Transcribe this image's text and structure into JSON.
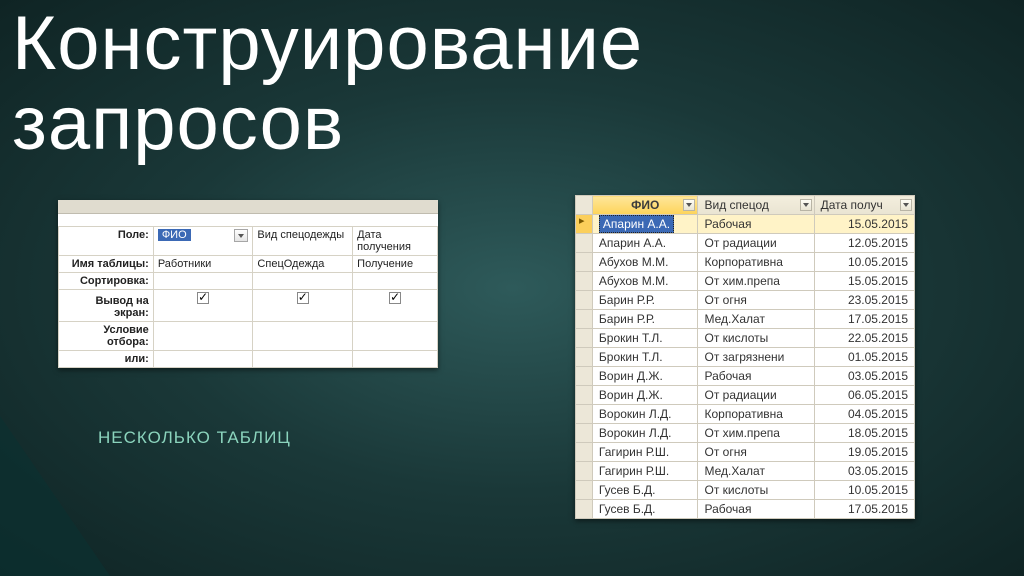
{
  "title_line1": "Конструирование",
  "title_line2": "запросов",
  "subtitle": "НЕСКОЛЬКО ТАБЛИЦ",
  "design": {
    "labels": {
      "field": "Поле:",
      "table": "Имя таблицы:",
      "sort": "Сортировка:",
      "show": "Вывод на экран:",
      "criteria": "Условие отбора:",
      "or": "или:"
    },
    "cols": [
      {
        "field": "ФИО",
        "table": "Работники",
        "show": true,
        "selected": true,
        "combo": true
      },
      {
        "field": "Вид спецодежды",
        "table": "СпецОдежда",
        "show": true
      },
      {
        "field": "Дата получения",
        "table": "Получение",
        "show": true
      }
    ]
  },
  "result": {
    "headers": {
      "fio": "ФИО",
      "vid": "Вид спецод",
      "date": "Дата получ"
    },
    "rows": [
      {
        "fio": "Апарин А.А.",
        "vid": "Рабочая",
        "date": "15.05.2015",
        "selected": true
      },
      {
        "fio": "Апарин А.А.",
        "vid": "От радиации",
        "date": "12.05.2015"
      },
      {
        "fio": "Абухов М.М.",
        "vid": "Корпоративна",
        "date": "10.05.2015"
      },
      {
        "fio": "Абухов М.М.",
        "vid": "От хим.препа",
        "date": "15.05.2015"
      },
      {
        "fio": "Барин Р.Р.",
        "vid": "От огня",
        "date": "23.05.2015"
      },
      {
        "fio": "Барин Р.Р.",
        "vid": "Мед.Халат",
        "date": "17.05.2015"
      },
      {
        "fio": "Брокин Т.Л.",
        "vid": "От кислоты",
        "date": "22.05.2015"
      },
      {
        "fio": "Брокин Т.Л.",
        "vid": "От загрязнени",
        "date": "01.05.2015"
      },
      {
        "fio": "Ворин Д.Ж.",
        "vid": "Рабочая",
        "date": "03.05.2015"
      },
      {
        "fio": "Ворин Д.Ж.",
        "vid": "От радиации",
        "date": "06.05.2015"
      },
      {
        "fio": "Ворокин Л.Д.",
        "vid": "Корпоративна",
        "date": "04.05.2015"
      },
      {
        "fio": "Ворокин Л.Д.",
        "vid": "От хим.препа",
        "date": "18.05.2015"
      },
      {
        "fio": "Гагирин Р.Ш.",
        "vid": "От огня",
        "date": "19.05.2015"
      },
      {
        "fio": "Гагирин Р.Ш.",
        "vid": "Мед.Халат",
        "date": "03.05.2015"
      },
      {
        "fio": "Гусев Б.Д.",
        "vid": "От кислоты",
        "date": "10.05.2015"
      },
      {
        "fio": "Гусев Б.Д.",
        "vid": "Рабочая",
        "date": "17.05.2015"
      }
    ]
  }
}
